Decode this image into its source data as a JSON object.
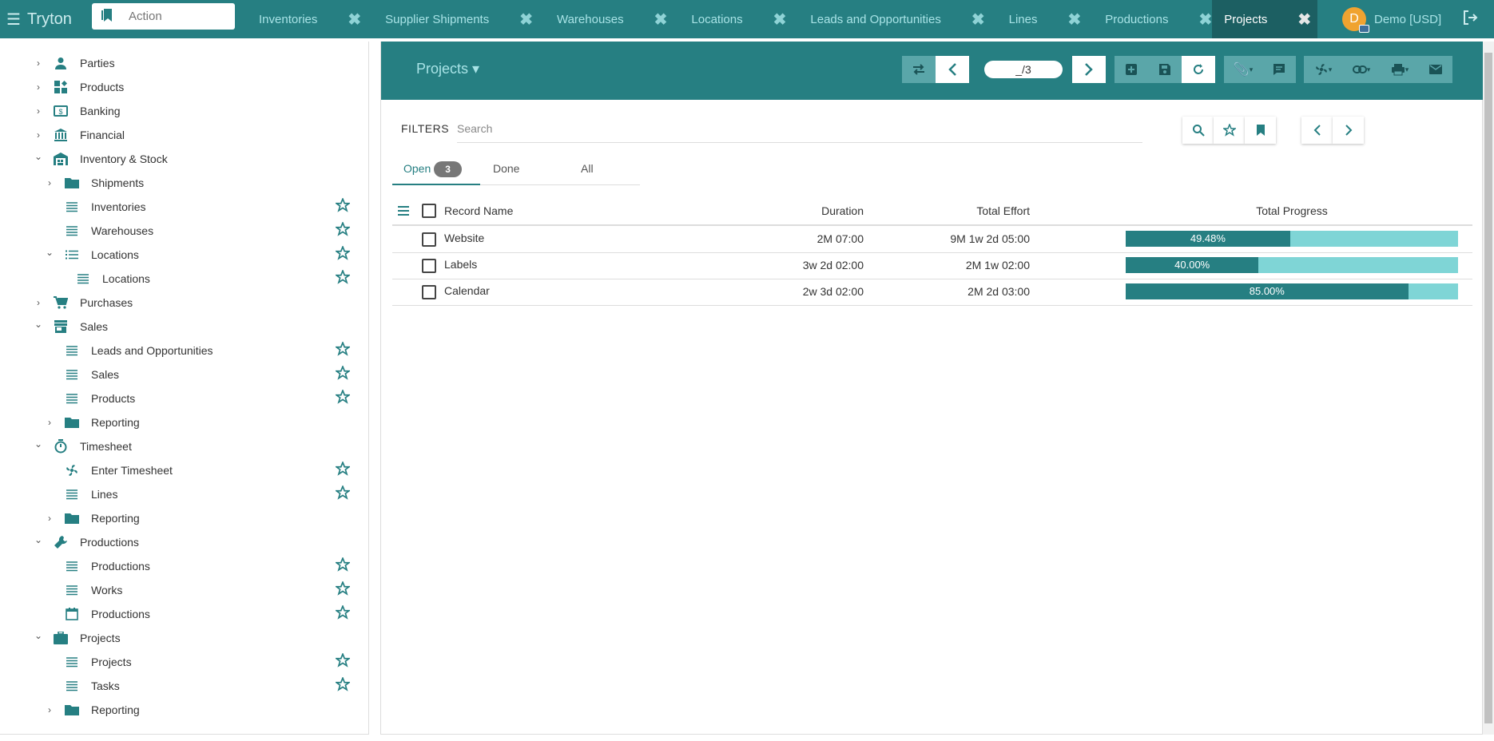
{
  "navbar": {
    "brand": "Tryton",
    "action_placeholder": "Action",
    "tabs": [
      {
        "label": "Inventories"
      },
      {
        "label": "Supplier Shipments"
      },
      {
        "label": "Warehouses"
      },
      {
        "label": "Locations"
      },
      {
        "label": "Leads and Opportunities"
      },
      {
        "label": "Lines"
      },
      {
        "label": "Productions"
      },
      {
        "label": "Projects",
        "active": true
      }
    ],
    "user_initial": "D",
    "user_label": "Demo [USD]"
  },
  "sidebar": {
    "items": [
      {
        "label": "Parties",
        "icon": "person-icon",
        "expand": "collapsed",
        "starred": false
      },
      {
        "label": "Products",
        "icon": "products-icon",
        "expand": "collapsed",
        "starred": false
      },
      {
        "label": "Banking",
        "icon": "banking-icon",
        "expand": "collapsed",
        "starred": false
      },
      {
        "label": "Financial",
        "icon": "bank-icon",
        "expand": "collapsed",
        "starred": false
      },
      {
        "label": "Inventory & Stock",
        "icon": "warehouse-icon",
        "expand": "expanded",
        "starred": false
      },
      {
        "label": "Shipments",
        "icon": "folder-icon",
        "expand": "collapsed",
        "starred": false
      },
      {
        "label": "Inventories",
        "icon": "list-icon",
        "expand": "none",
        "starred": true
      },
      {
        "label": "Warehouses",
        "icon": "list-icon",
        "expand": "none",
        "starred": true
      },
      {
        "label": "Locations",
        "icon": "tree-list-icon",
        "expand": "expanded",
        "starred": true
      },
      {
        "label": "Locations",
        "icon": "list-icon",
        "expand": "none",
        "starred": true
      },
      {
        "label": "Purchases",
        "icon": "cart-icon",
        "expand": "collapsed",
        "starred": false
      },
      {
        "label": "Sales",
        "icon": "store-icon",
        "expand": "expanded",
        "starred": false
      },
      {
        "label": "Leads and Opportunities",
        "icon": "list-icon",
        "expand": "none",
        "starred": true
      },
      {
        "label": "Sales",
        "icon": "list-icon",
        "expand": "none",
        "starred": true
      },
      {
        "label": "Products",
        "icon": "list-icon",
        "expand": "none",
        "starred": true
      },
      {
        "label": "Reporting",
        "icon": "folder-icon",
        "expand": "collapsed",
        "starred": false
      },
      {
        "label": "Timesheet",
        "icon": "timer-icon",
        "expand": "expanded",
        "starred": false
      },
      {
        "label": "Enter Timesheet",
        "icon": "wizard-icon",
        "expand": "none",
        "starred": true
      },
      {
        "label": "Lines",
        "icon": "list-icon",
        "expand": "none",
        "starred": true
      },
      {
        "label": "Reporting",
        "icon": "folder-icon",
        "expand": "collapsed",
        "starred": false
      },
      {
        "label": "Productions",
        "icon": "wrench-icon",
        "expand": "expanded",
        "starred": false
      },
      {
        "label": "Productions",
        "icon": "list-icon",
        "expand": "none",
        "starred": true
      },
      {
        "label": "Works",
        "icon": "list-icon",
        "expand": "none",
        "starred": true
      },
      {
        "label": "Productions",
        "icon": "calendar-icon",
        "expand": "none",
        "starred": true
      },
      {
        "label": "Projects",
        "icon": "briefcase-icon",
        "expand": "expanded",
        "starred": false
      },
      {
        "label": "Projects",
        "icon": "list-icon",
        "expand": "none",
        "starred": true
      },
      {
        "label": "Tasks",
        "icon": "list-icon",
        "expand": "none",
        "starred": true
      },
      {
        "label": "Reporting",
        "icon": "folder-icon",
        "expand": "collapsed",
        "starred": false
      }
    ]
  },
  "main": {
    "title": "Projects",
    "pager": "_/3",
    "filters_label": "FILTERS",
    "search_placeholder": "Search",
    "state_tabs": [
      {
        "label": "Open",
        "count": "3",
        "active": true
      },
      {
        "label": "Done"
      },
      {
        "label": "All"
      }
    ],
    "columns": [
      "Record Name",
      "Duration",
      "Total Effort",
      "Total Progress"
    ],
    "rows": [
      {
        "name": "Website",
        "duration": "2M 07:00",
        "effort": "9M 1w 2d 05:00",
        "progress_label": "49.48%",
        "progress": 0.4948
      },
      {
        "name": "Labels",
        "duration": "3w 2d 02:00",
        "effort": "2M 1w 02:00",
        "progress_label": "40.00%",
        "progress": 0.4
      },
      {
        "name": "Calendar",
        "duration": "2w 3d 02:00",
        "effort": "2M 2d 03:00",
        "progress_label": "85.00%",
        "progress": 0.85
      }
    ]
  },
  "colors": {
    "primary": "#267f82",
    "primary_dark": "#1c5f62",
    "progress_bg": "#7fd5d6",
    "avatar": "#f0a330"
  }
}
